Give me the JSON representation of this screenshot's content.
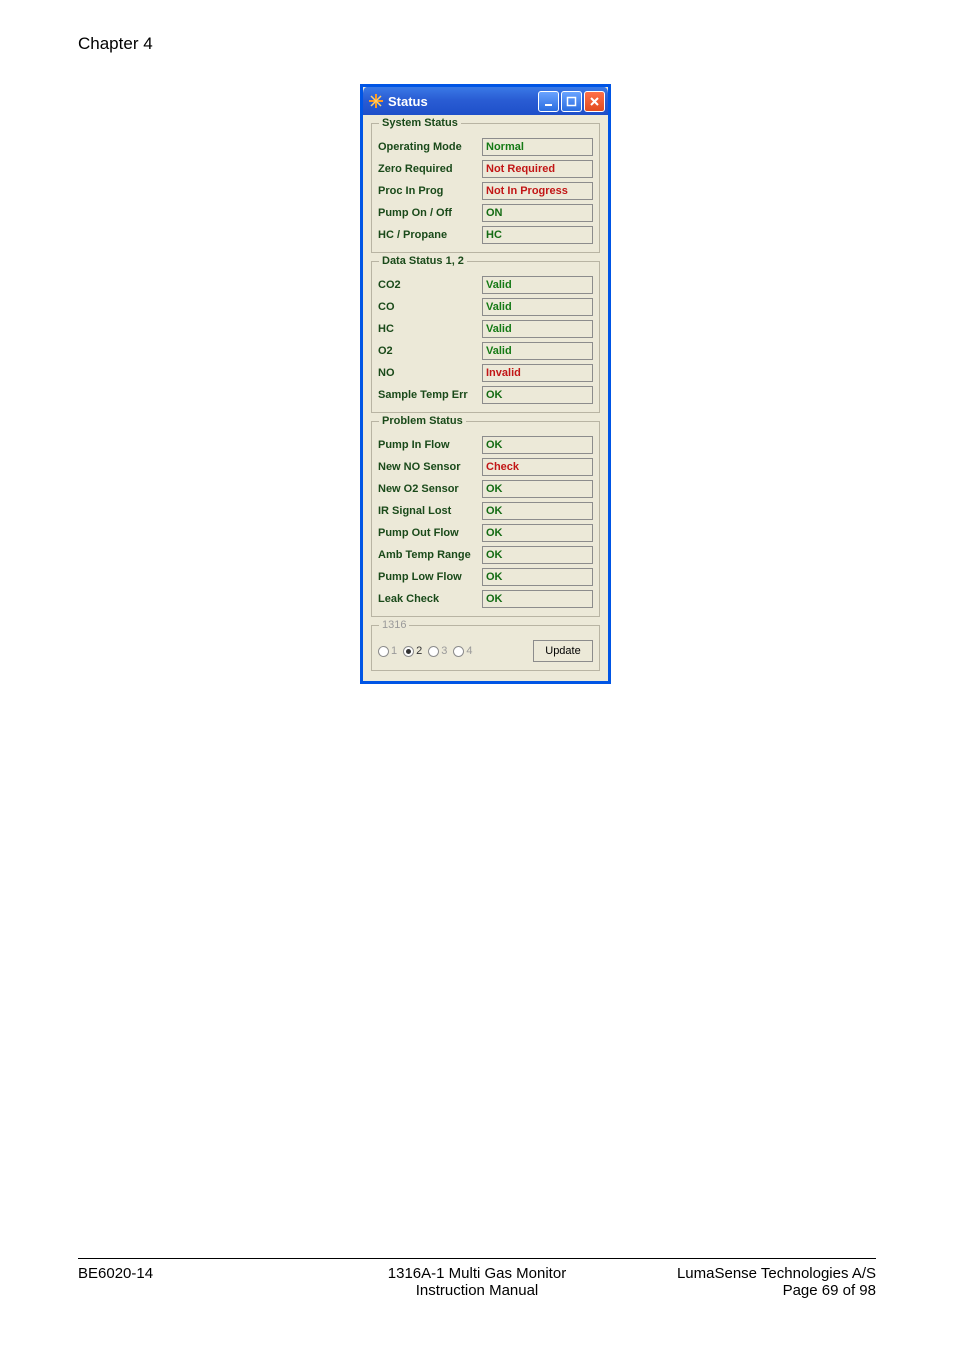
{
  "page": {
    "chapter": "Chapter 4",
    "footer_left": "BE6020-14",
    "footer_center_1": "1316A-1 Multi Gas Monitor",
    "footer_center_2": "Instruction Manual",
    "footer_right_1": "LumaSense Technologies A/S",
    "footer_right_2": "Page 69 of 98"
  },
  "window": {
    "title": "Status",
    "groups": {
      "system": {
        "legend": "System Status",
        "rows": [
          {
            "label": "Operating Mode",
            "value": "Normal",
            "color": "green"
          },
          {
            "label": "Zero Required",
            "value": "Not Required",
            "color": "red"
          },
          {
            "label": "Proc In Prog",
            "value": "Not In Progress",
            "color": "red"
          },
          {
            "label": "Pump On / Off",
            "value": "ON",
            "color": "dark"
          },
          {
            "label": "HC / Propane",
            "value": "HC",
            "color": "dark"
          }
        ]
      },
      "data": {
        "legend": "Data Status 1, 2",
        "rows": [
          {
            "label": "CO2",
            "value": "Valid",
            "color": "green"
          },
          {
            "label": "CO",
            "value": "Valid",
            "color": "green"
          },
          {
            "label": "HC",
            "value": "Valid",
            "color": "green"
          },
          {
            "label": "O2",
            "value": "Valid",
            "color": "green"
          },
          {
            "label": "NO",
            "value": "Invalid",
            "color": "red"
          },
          {
            "label": "Sample Temp Err",
            "value": "OK",
            "color": "dark"
          }
        ]
      },
      "problem": {
        "legend": "Problem Status",
        "rows": [
          {
            "label": "Pump In Flow",
            "value": "OK",
            "color": "dark"
          },
          {
            "label": "New NO   Sensor",
            "value": "Check",
            "color": "red"
          },
          {
            "label": "New O2 Sensor",
            "value": "OK",
            "color": "dark"
          },
          {
            "label": "IR Signal Lost",
            "value": "OK",
            "color": "dark"
          },
          {
            "label": "Pump Out Flow",
            "value": "OK",
            "color": "dark"
          },
          {
            "label": "Amb Temp Range",
            "value": "OK",
            "color": "dark"
          },
          {
            "label": "Pump Low Flow",
            "value": "OK",
            "color": "dark"
          },
          {
            "label": "Leak Check",
            "value": "OK",
            "color": "dark"
          }
        ]
      },
      "selector": {
        "legend": "1316",
        "options": [
          "1",
          "2",
          "3",
          "4"
        ],
        "selected_index": 1,
        "button": "Update"
      }
    }
  }
}
